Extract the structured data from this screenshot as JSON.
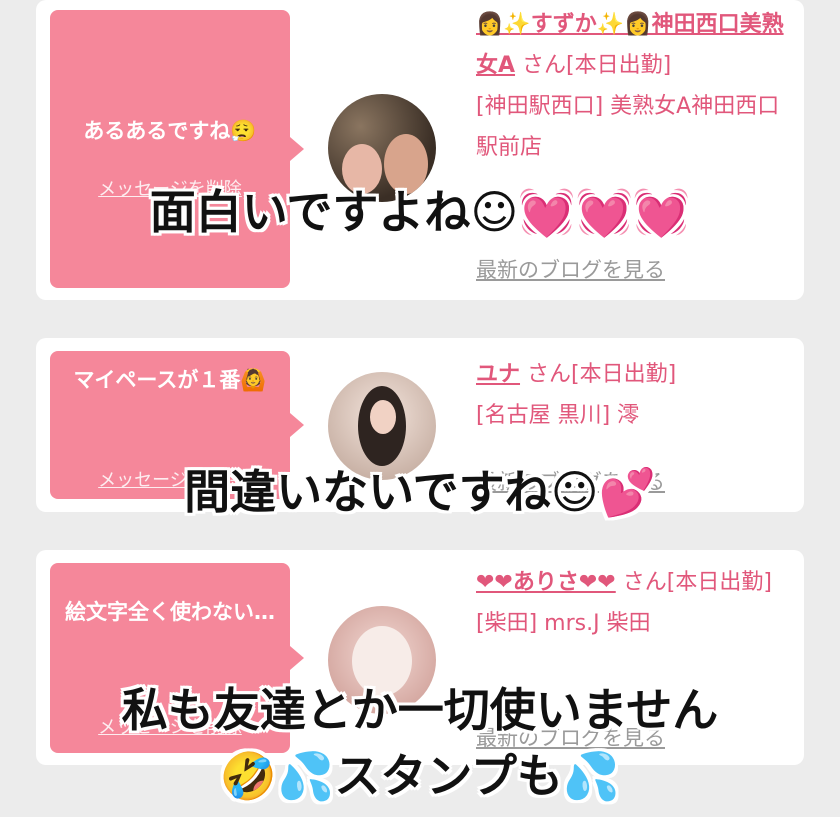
{
  "colors": {
    "pink_bubble": "#f5879a",
    "pink_text": "#e1577b",
    "link_gray": "#9a9a9a",
    "bg": "#ececec"
  },
  "cards": [
    {
      "message": "あるあるですね😮‍💨",
      "delete_label": "メッセージを削除",
      "name": "👩✨すずか✨👩神田西口美熟女A",
      "san": " さん[本日出勤]",
      "shop": "[神田駅西口] 美熟女A神田西口駅前店",
      "blog": "最新のブログを見る"
    },
    {
      "message": "マイペースが１番🙆",
      "delete_label": "メッセージを削除",
      "name": "ユナ",
      "san": " さん[本日出勤]",
      "shop": "[名古屋 黒川] 澪",
      "blog": "最新のブログを見る"
    },
    {
      "message": "絵文字全く使わない…",
      "delete_label": "メッセージを削除",
      "name": "❤❤ありさ❤❤",
      "san": " さん[本日出勤]",
      "shop": "[柴田] mrs.J 柴田",
      "blog": "最新のブログを見る"
    }
  ],
  "captions": [
    "面白いですよね☺💓💓💓",
    "間違いないですね☺💕",
    "私も友達とか一切使いません",
    "🤣💦スタンプも💦"
  ]
}
